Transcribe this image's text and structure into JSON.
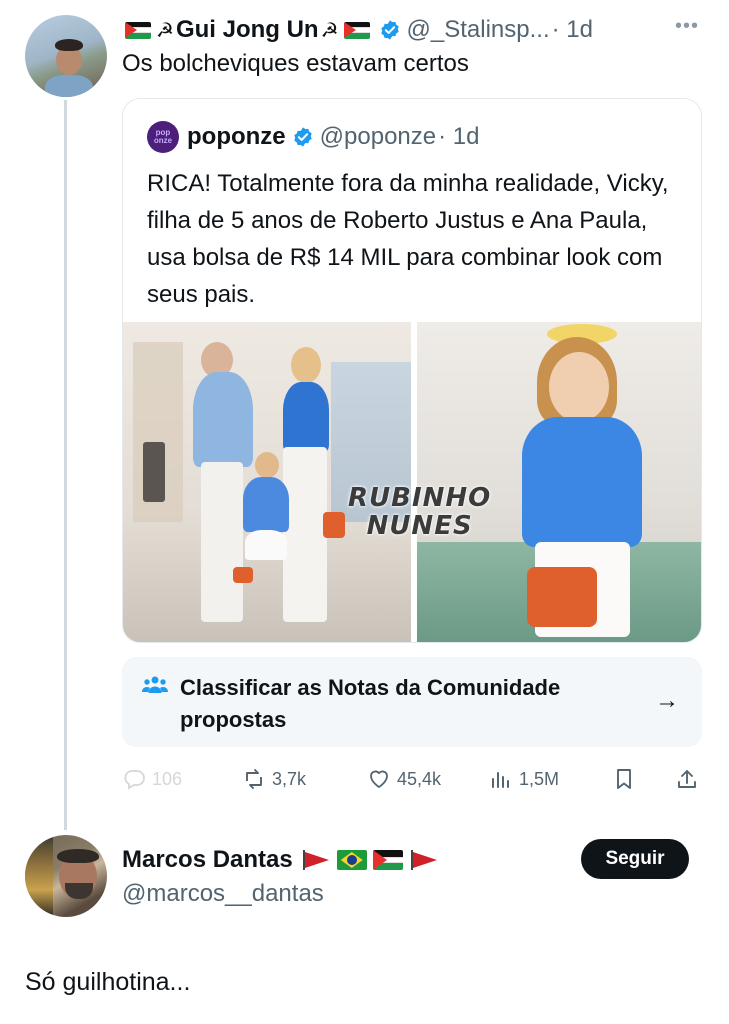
{
  "tweet": {
    "author_name": "Gui Jong Un",
    "handle": "@_Stalinsp...",
    "time": "· 1d",
    "text": "Os bolcheviques estavam certos",
    "more_icon": "more-horizontal-icon"
  },
  "quote": {
    "author_name": "poponze",
    "avatar_text": "pop onze",
    "handle": "@poponze",
    "time": "· 1d",
    "text": "RICA! Totalmente fora da minha realidade, Vicky, filha de 5 anos de Roberto Justus e Ana Paula, usa bolsa de R$ 14 MIL para combinar look com seus pais.",
    "watermark_line1": "RUBINHO",
    "watermark_line2": "NUNES"
  },
  "community_notes": {
    "label": "Classificar as Notas da Comunidade propostas",
    "icon": "people-icon",
    "arrow": "→"
  },
  "actions": {
    "replies": "106",
    "retweets": "3,7k",
    "likes": "45,4k",
    "views": "1,5M"
  },
  "reply": {
    "author_name": "Marcos Dantas",
    "handle": "@marcos__dantas",
    "follow_label": "Seguir",
    "text": "Só guilhotina..."
  },
  "colors": {
    "verified_blue": "#1d9bf0",
    "text_primary": "#0f1419",
    "text_secondary": "#536471",
    "notes_bg": "#f4f7f9"
  }
}
